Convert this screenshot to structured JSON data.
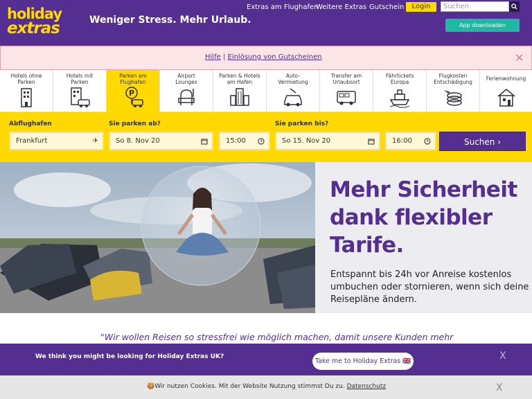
{
  "header": {
    "logo_line1": "holiday",
    "logo_line2": "extras",
    "tagline": "Weniger Stress. Mehr Urlaub.",
    "nav": [
      "Extras am Flughafen",
      "Weitere Extras",
      "Gutschein"
    ],
    "login_label": "Login",
    "search_placeholder": "Suchen",
    "app_button": "App downloaden",
    "brand_color": "#542e91",
    "accent_color": "#ffd900"
  },
  "infobar": {
    "help_link": "Hilfe",
    "separator": "|",
    "voucher_link": "Einlösung von Gutscheinen"
  },
  "tabs": [
    {
      "label": "Hotels ohne Parken",
      "icon": "hotel-building-icon"
    },
    {
      "label": "Hotels mit Parken",
      "icon": "hotel-car-icon"
    },
    {
      "label": "Parken am Flughafen",
      "icon": "airport-parking-icon",
      "active": true
    },
    {
      "label": "Airport Lounges",
      "icon": "lounge-chair-icon"
    },
    {
      "label": "Parken & Hotels am Hafen",
      "icon": "port-hotel-icon"
    },
    {
      "label": "Auto-Vermietung",
      "icon": "car-rental-icon"
    },
    {
      "label": "Transfer am Urlaubsort",
      "icon": "transfer-van-icon"
    },
    {
      "label": "Fährtickets Europa",
      "icon": "ferry-icon"
    },
    {
      "label": "Flugkosten Entschädigung",
      "icon": "compensation-coins-icon"
    },
    {
      "label": "Ferienwohnung",
      "icon": "holiday-home-icon"
    }
  ],
  "form": {
    "airport_label": "Abflughafen",
    "airport_value": "Frankfurt",
    "from_label": "Sie parken ab?",
    "from_date": "So 8. Nov 20",
    "from_time": "15:00",
    "to_label": "Sie parken bis?",
    "to_date": "So 15. Nov 20",
    "to_time": "16:00",
    "search_button": "Suchen"
  },
  "hero": {
    "title": "Mehr Sicherheit dank flexibler Tarife.",
    "subtitle": "Entspannt bis 24h vor Anreise kostenlos umbuchen oder stornieren, wenn sich deine Reisepläne ändern."
  },
  "quote": "\"Wir wollen Reisen so stressfrei wie möglich machen, damit unsere Kunden mehr",
  "banner": {
    "text": "We think you might be looking for Holiday Extras UK?",
    "button": "Take me to Holiday Extras 🇬🇧",
    "close": "X"
  },
  "cookie": {
    "emoji": "🍪",
    "text": "Wir nutzen Cookies. Mit der Website Nutzung stimmst Du zu.",
    "link": "Datenschutz",
    "close": "X"
  }
}
